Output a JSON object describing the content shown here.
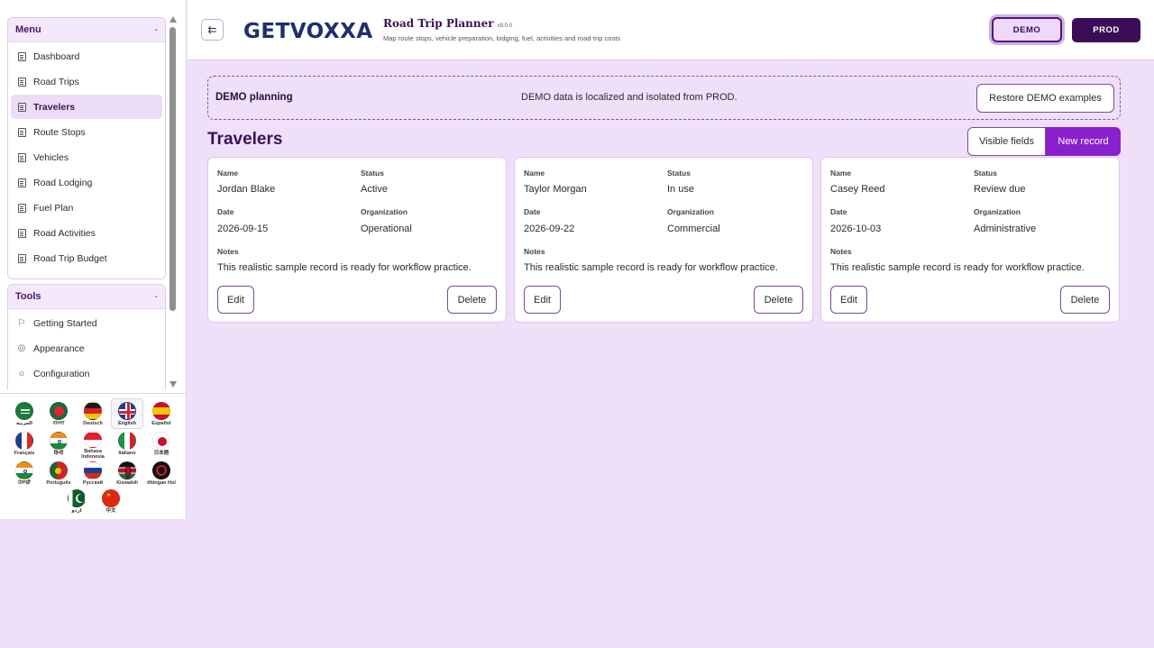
{
  "sidebar": {
    "menu": {
      "title": "Menu",
      "caret": "-",
      "items": [
        {
          "label": "Dashboard",
          "icon": "document-icon",
          "active": false
        },
        {
          "label": "Road Trips",
          "icon": "document-icon",
          "active": false
        },
        {
          "label": "Travelers",
          "icon": "document-icon",
          "active": true
        },
        {
          "label": "Route Stops",
          "icon": "document-icon",
          "active": false
        },
        {
          "label": "Vehicles",
          "icon": "document-icon",
          "active": false
        },
        {
          "label": "Road Lodging",
          "icon": "document-icon",
          "active": false
        },
        {
          "label": "Fuel Plan",
          "icon": "document-icon",
          "active": false
        },
        {
          "label": "Road Activities",
          "icon": "document-icon",
          "active": false
        },
        {
          "label": "Road Trip Budget",
          "icon": "document-icon",
          "active": false
        }
      ]
    },
    "tools": {
      "title": "Tools",
      "caret": "-",
      "items": [
        {
          "label": "Getting Started",
          "icon": "flag-icon"
        },
        {
          "label": "Appearance",
          "icon": "palette-icon"
        },
        {
          "label": "Configuration",
          "icon": "gear-icon"
        }
      ]
    }
  },
  "languages": [
    {
      "label": "العربية",
      "name": "flag-arabic"
    },
    {
      "label": "বাংলা",
      "name": "flag-bengali"
    },
    {
      "label": "Deutsch",
      "name": "flag-german"
    },
    {
      "label": "English",
      "name": "flag-english",
      "selected": true
    },
    {
      "label": "Español",
      "name": "flag-spanish"
    },
    {
      "label": "Français",
      "name": "flag-french"
    },
    {
      "label": "हिन्दी",
      "name": "flag-hindi"
    },
    {
      "label": "Bahasa Indonesia",
      "name": "flag-indonesian"
    },
    {
      "label": "Italiano",
      "name": "flag-italian"
    },
    {
      "label": "日本語",
      "name": "flag-japanese"
    },
    {
      "label": "ਪੰਜਾਬੀ",
      "name": "flag-punjabi"
    },
    {
      "label": "Português",
      "name": "flag-portuguese"
    },
    {
      "label": "Русский",
      "name": "flag-russian"
    },
    {
      "label": "Kiswahili",
      "name": "flag-swahili"
    },
    {
      "label": "tlhIngan Hol",
      "name": "flag-klingon"
    },
    {
      "label": "اردو",
      "name": "flag-urdu"
    },
    {
      "label": "中文",
      "name": "flag-chinese"
    }
  ],
  "header": {
    "logo_text": "GETVOXXA",
    "title": "Road Trip Planner",
    "version": "v9.0.0",
    "subtitle": "Map route stops, vehicle preparation, lodging, fuel, activities and road-trip costs",
    "env_demo": "DEMO",
    "env_prod": "PROD"
  },
  "banner": {
    "title": "DEMO planning",
    "message": "DEMO data is localized and isolated from PROD.",
    "restore_label": "Restore DEMO examples"
  },
  "main": {
    "title": "Travelers",
    "visible_fields_label": "Visible fields",
    "new_record_label": "New record"
  },
  "field_labels": {
    "name": "Name",
    "status": "Status",
    "date": "Date",
    "organization": "Organization",
    "notes": "Notes"
  },
  "buttons": {
    "edit": "Edit",
    "delete": "Delete"
  },
  "records": [
    {
      "name": "Jordan Blake",
      "status": "Active",
      "date": "2026-09-15",
      "organization": "Operational",
      "notes": "This realistic sample record is ready for workflow practice."
    },
    {
      "name": "Taylor Morgan",
      "status": "In use",
      "date": "2026-09-22",
      "organization": "Commercial",
      "notes": "This realistic sample record is ready for workflow practice."
    },
    {
      "name": "Casey Reed",
      "status": "Review due",
      "date": "2026-10-03",
      "organization": "Administrative",
      "notes": "This realistic sample record is ready for workflow practice."
    }
  ],
  "colors": {
    "accent": "#8a1fcc",
    "brand_dark": "#3b0c58",
    "background": "#efdff8"
  }
}
